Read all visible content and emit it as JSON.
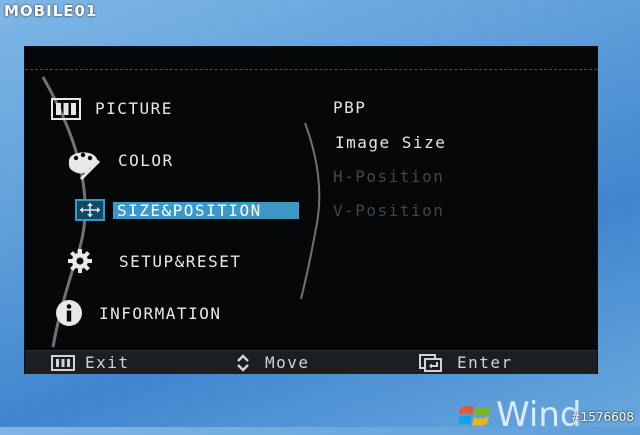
{
  "watermark": "MOBILE01",
  "photo_id": "#1576608",
  "windows_partial_text": "Wind",
  "osd": {
    "main_menu": [
      {
        "label": "PICTURE",
        "icon": "picture-icon",
        "selected": false
      },
      {
        "label": "COLOR",
        "icon": "palette-icon",
        "selected": false
      },
      {
        "label": "SIZE&POSITION",
        "icon": "size-position-icon",
        "selected": true
      },
      {
        "label": "SETUP&RESET",
        "icon": "gear-icon",
        "selected": false
      },
      {
        "label": "INFORMATION",
        "icon": "info-icon",
        "selected": false
      }
    ],
    "submenu": [
      {
        "label": "PBP",
        "enabled": true
      },
      {
        "label": "Image Size",
        "enabled": true
      },
      {
        "label": "H-Position",
        "enabled": false
      },
      {
        "label": "V-Position",
        "enabled": false
      }
    ],
    "bottom_bar": {
      "exit_label": "Exit",
      "move_label": "Move",
      "enter_label": "Enter"
    },
    "colors": {
      "background": "#050708",
      "selection": "#3c98c8",
      "text": "#e6e8ea",
      "disabled_text": "#40464b"
    }
  }
}
